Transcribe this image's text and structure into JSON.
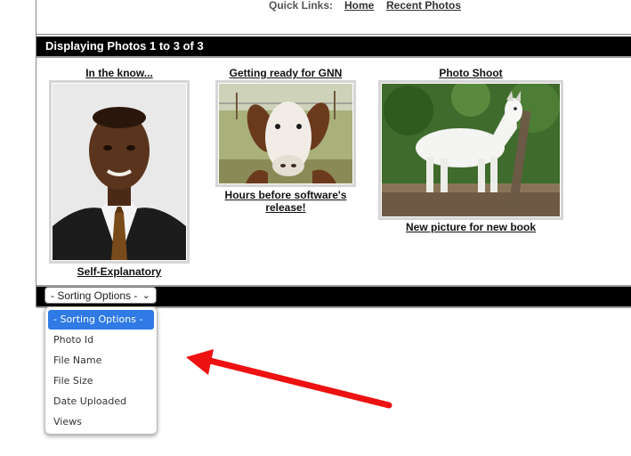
{
  "quick_links": {
    "label": "Quick Links:",
    "home": "Home",
    "recent": "Recent Photos"
  },
  "gallery": {
    "header": "Displaying Photos 1 to 3 of 3",
    "photos": [
      {
        "title": "In the know...",
        "caption": "Self-Explanatory"
      },
      {
        "title": "Getting ready for GNN",
        "caption": "Hours before software's release!"
      },
      {
        "title": "Photo Shoot",
        "caption": "New picture for new book"
      }
    ]
  },
  "sorting": {
    "selected": "- Sorting Options -",
    "options": [
      "- Sorting Options -",
      "Photo Id",
      "File Name",
      "File Size",
      "Date Uploaded",
      "Views"
    ]
  },
  "colors": {
    "bar": "#000000",
    "highlight": "#2f7ae5",
    "arrow": "#ee1111"
  }
}
